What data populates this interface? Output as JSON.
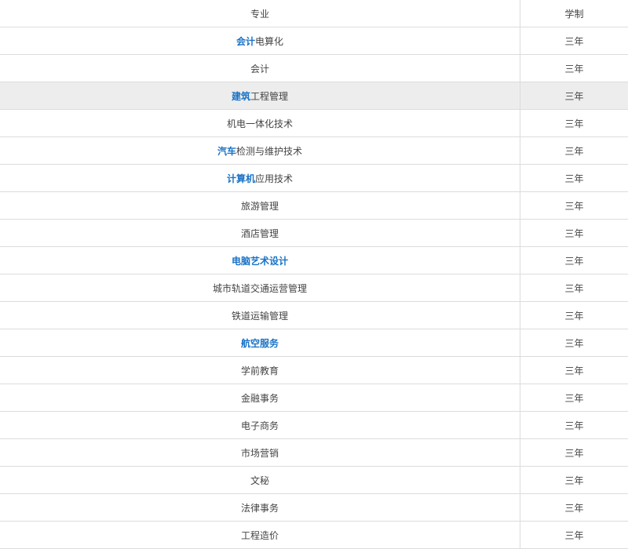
{
  "table": {
    "headers": {
      "major": "专业",
      "duration": "学制"
    },
    "rows": [
      {
        "link": "会计",
        "rest": "电算化",
        "duration": "三年"
      },
      {
        "link": "",
        "rest": "会计",
        "duration": "三年"
      },
      {
        "link": "建筑",
        "rest": "工程管理",
        "duration": "三年",
        "highlight": true
      },
      {
        "link": "",
        "rest": "机电一体化技术",
        "duration": "三年"
      },
      {
        "link": "汽车",
        "rest": "检测与维护技术",
        "duration": "三年"
      },
      {
        "link": "计算机",
        "rest": "应用技术",
        "duration": "三年"
      },
      {
        "link": "",
        "rest": "旅游管理",
        "duration": "三年"
      },
      {
        "link": "",
        "rest": "酒店管理",
        "duration": "三年"
      },
      {
        "link": "电脑艺术设计",
        "rest": "",
        "duration": "三年"
      },
      {
        "link": "",
        "rest": "城市轨道交通运营管理",
        "duration": "三年"
      },
      {
        "link": "",
        "rest": "铁道运输管理",
        "duration": "三年"
      },
      {
        "link": "航空服务",
        "rest": "",
        "duration": "三年"
      },
      {
        "link": "",
        "rest": "学前教育",
        "duration": "三年"
      },
      {
        "link": "",
        "rest": "金融事务",
        "duration": "三年"
      },
      {
        "link": "",
        "rest": "电子商务",
        "duration": "三年"
      },
      {
        "link": "",
        "rest": "市场营销",
        "duration": "三年"
      },
      {
        "link": "",
        "rest": "文秘",
        "duration": "三年"
      },
      {
        "link": "",
        "rest": "法律事务",
        "duration": "三年"
      },
      {
        "link": "",
        "rest": "工程造价",
        "duration": "三年"
      }
    ]
  },
  "colors": {
    "link": "#1a73c7",
    "text": "#444444",
    "border": "#dcdcdc",
    "highlight_row": "#ededed"
  }
}
